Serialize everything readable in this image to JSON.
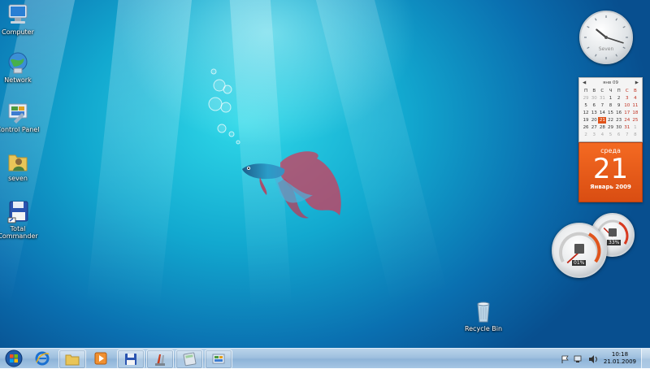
{
  "desktop_icons": [
    {
      "label": "Computer",
      "icon": "computer-icon"
    },
    {
      "label": "Network",
      "icon": "network-globe-icon"
    },
    {
      "label": "Control Panel",
      "icon": "control-panel-icon"
    },
    {
      "label": "seven",
      "icon": "user-folder-icon"
    },
    {
      "label": "Total Commander",
      "icon": "floppy-disk-icon"
    },
    {
      "label": "Recycle Bin",
      "icon": "recycle-bin-icon"
    }
  ],
  "clock_gadget": {
    "brand": "Seven",
    "hour": 10,
    "minute": 18
  },
  "calendar_gadget": {
    "month_header": "янв 09",
    "weekdays": [
      "П",
      "В",
      "С",
      "Ч",
      "П",
      "С",
      "В"
    ],
    "days": [
      [
        "29",
        "30",
        "31",
        "1",
        "2",
        "3",
        "4"
      ],
      [
        "5",
        "6",
        "7",
        "8",
        "9",
        "10",
        "11"
      ],
      [
        "12",
        "13",
        "14",
        "15",
        "16",
        "17",
        "18"
      ],
      [
        "19",
        "20",
        "21",
        "22",
        "23",
        "24",
        "25"
      ],
      [
        "26",
        "27",
        "28",
        "29",
        "30",
        "31",
        "1"
      ],
      [
        "2",
        "3",
        "4",
        "5",
        "6",
        "7",
        "8"
      ]
    ],
    "today": "21",
    "day_name": "среда",
    "day_number": "21",
    "month_year": "Январь 2009"
  },
  "cpu_meter": {
    "cpu_label": "01%",
    "memory_label": "33%",
    "cpu_value": 1,
    "memory_value": 33
  },
  "taskbar": {
    "start": "start-orb-icon",
    "items": [
      "internet-explorer-icon",
      "windows-explorer-icon",
      "media-player-icon",
      "floppy-save-icon",
      "paint-tools-icon",
      "calculator-icon",
      "control-panel-icon"
    ],
    "tray": [
      "flag-icon",
      "network-icon",
      "volume-icon"
    ],
    "time": "10:18",
    "date": "21.01.2009"
  },
  "colors": {
    "accent_orange": "#e85b1c",
    "taskbar": "#a6c6e4",
    "desktop": "#12a8cf"
  }
}
